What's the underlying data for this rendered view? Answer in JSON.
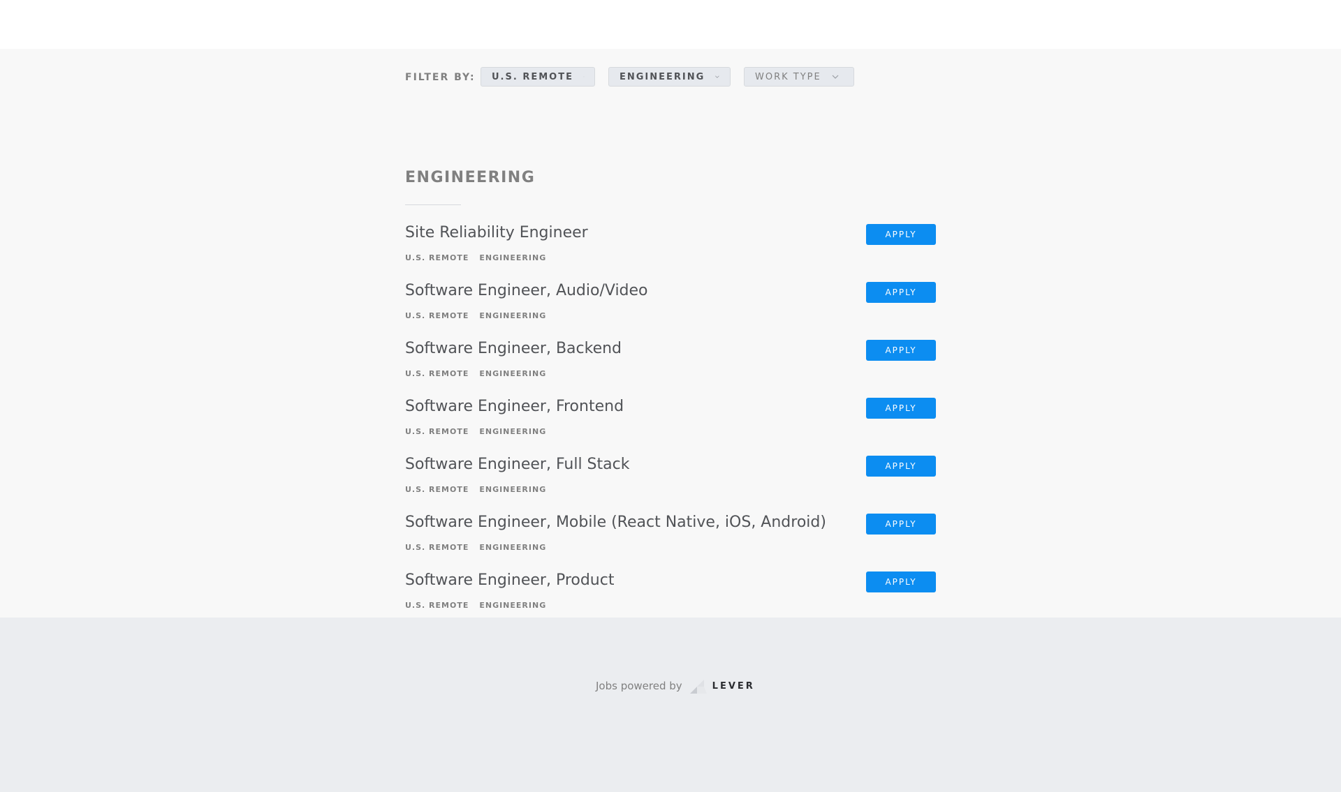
{
  "filter": {
    "label": "Filter by:",
    "location": "U.S. Remote",
    "team": "Engineering",
    "work_type": "Work type"
  },
  "section": {
    "title": "Engineering"
  },
  "postings": [
    {
      "title": "Site Reliability Engineer",
      "location": "U.S. Remote",
      "team": "Engineering",
      "apply": "Apply"
    },
    {
      "title": "Software Engineer, Audio/Video",
      "location": "U.S. Remote",
      "team": "Engineering",
      "apply": "Apply"
    },
    {
      "title": "Software Engineer, Backend",
      "location": "U.S. Remote",
      "team": "Engineering",
      "apply": "Apply"
    },
    {
      "title": "Software Engineer, Frontend",
      "location": "U.S. Remote",
      "team": "Engineering",
      "apply": "Apply"
    },
    {
      "title": "Software Engineer, Full Stack",
      "location": "U.S. Remote",
      "team": "Engineering",
      "apply": "Apply"
    },
    {
      "title": "Software Engineer, Mobile (React Native, iOS, Android)",
      "location": "U.S. Remote",
      "team": "Engineering",
      "apply": "Apply"
    },
    {
      "title": "Software Engineer, Product",
      "location": "U.S. Remote",
      "team": "Engineering",
      "apply": "Apply"
    }
  ],
  "footer": {
    "powered_text": "Jobs powered by",
    "brand": "LEVER",
    "brand_icon": "lever-logo-icon"
  },
  "colors": {
    "accent": "#0c8df1",
    "page_bg": "#f8f8f8",
    "footer_bg": "#ebedf0"
  }
}
